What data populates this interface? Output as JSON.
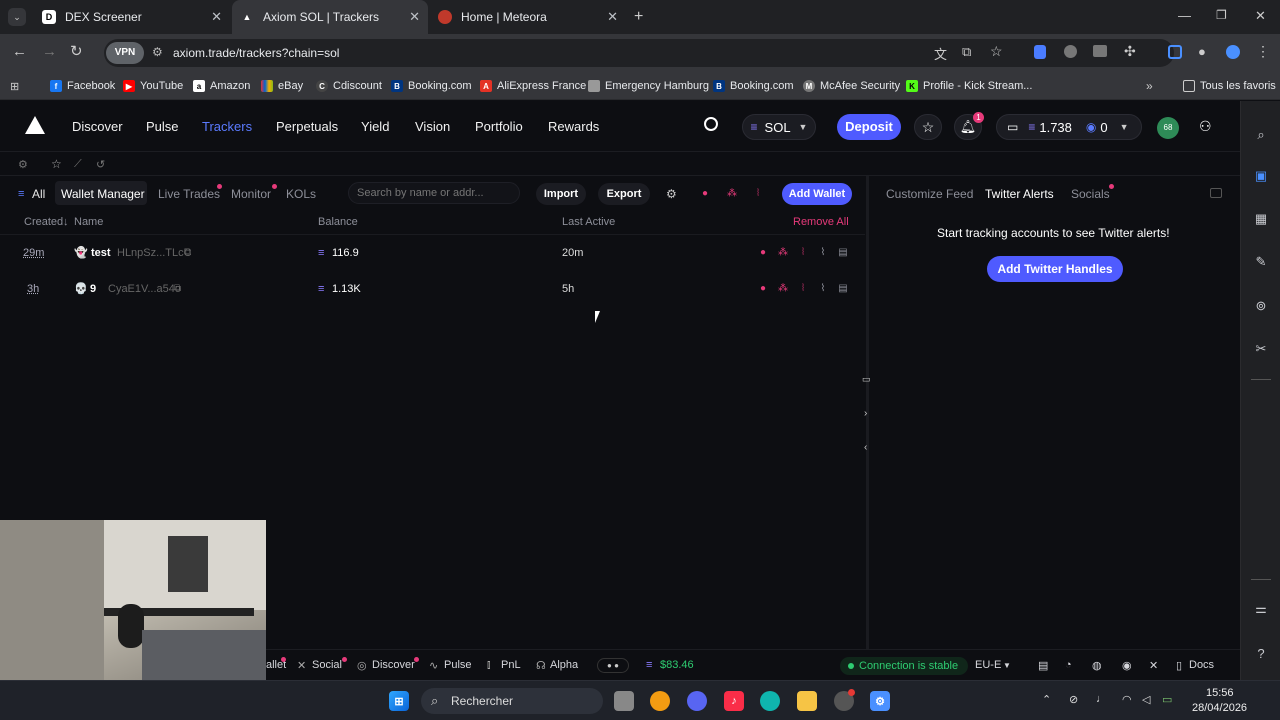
{
  "browser": {
    "tabs": [
      {
        "title": "DEX Screener",
        "active": false
      },
      {
        "title": "Axiom SOL | Trackers",
        "active": true
      },
      {
        "title": "Home | Meteora",
        "active": false
      }
    ],
    "vpn_badge": "VPN",
    "url": "axiom.trade/trackers?chain=sol",
    "bookmarks": [
      "Facebook",
      "YouTube",
      "Amazon",
      "eBay",
      "Cdiscount",
      "Booking.com",
      "AliExpress France",
      "Emergency Hamburg",
      "Booking.com",
      "McAfee Security",
      "Profile - Kick Stream..."
    ],
    "all_bookmarks": "Tous les favoris"
  },
  "nav": {
    "links": [
      "Discover",
      "Pulse",
      "Trackers",
      "Perpetuals",
      "Yield",
      "Vision",
      "Portfolio",
      "Rewards"
    ],
    "active": "Trackers",
    "chain": "SOL",
    "deposit": "Deposit",
    "notif_count": "1",
    "sol_balance": "1.738",
    "points": "0",
    "avatar": "68"
  },
  "tracker": {
    "tabs": [
      "All",
      "Wallet Manager",
      "Live Trades",
      "Monitor",
      "KOLs"
    ],
    "search_placeholder": "Search by name or addr...",
    "import": "Import",
    "export": "Export",
    "add_wallet": "Add Wallet",
    "headers": {
      "created": "Created",
      "name": "Name",
      "balance": "Balance",
      "last_active": "Last Active",
      "remove_all": "Remove All"
    },
    "rows": [
      {
        "created": "29m",
        "name": "test",
        "addr": "HLnpSz...TLcC",
        "balance": "116.9",
        "last_active": "20m"
      },
      {
        "created": "3h",
        "name": "9",
        "addr": "CyaE1V...a54o",
        "balance": "1.13K",
        "last_active": "5h"
      }
    ]
  },
  "twitter": {
    "tabs": [
      "Customize Feed",
      "Twitter Alerts",
      "Socials"
    ],
    "empty": "Start tracking accounts to see Twitter alerts!",
    "add_button": "Add Twitter Handles"
  },
  "footer": {
    "items": [
      "allet",
      "Social",
      "Discover",
      "Pulse",
      "PnL",
      "Alpha"
    ],
    "sol_price": "$83.46",
    "connection": "Connection is stable",
    "region": "EU-E",
    "docs": "Docs"
  },
  "taskbar": {
    "search": "Rechercher",
    "time": "15:56",
    "date": "28/04/2026"
  },
  "colors": {
    "accent": "#5b6bff",
    "pink": "#e63a7a",
    "green": "#2ecc71"
  }
}
